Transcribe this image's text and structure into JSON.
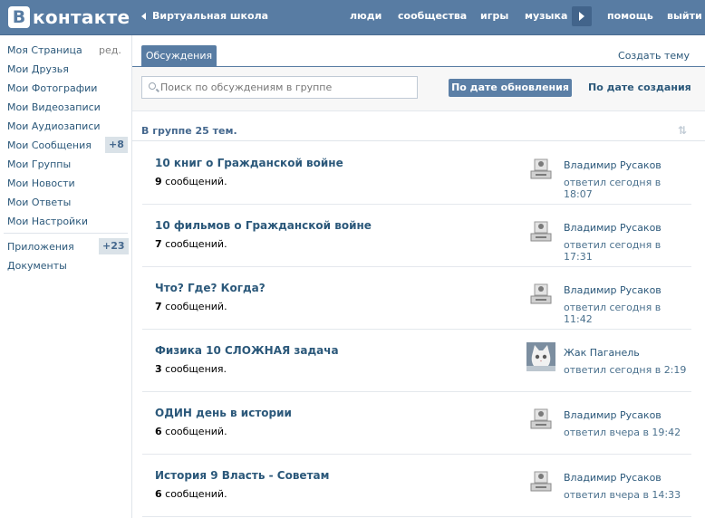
{
  "header": {
    "logo_letter": "В",
    "logo_text": "контакте",
    "back_label": "Виртуальная школа",
    "nav": [
      "люди",
      "сообщества",
      "игры",
      "музыка",
      "помощь",
      "выйти"
    ]
  },
  "sidebar": {
    "items": [
      {
        "label": "Моя Страница"
      },
      {
        "label": "Мои Друзья"
      },
      {
        "label": "Мои Фотографии"
      },
      {
        "label": "Мои Видеозаписи"
      },
      {
        "label": "Мои Аудиозаписи"
      },
      {
        "label": "Мои Сообщения",
        "badge": "+8"
      },
      {
        "label": "Мои Группы"
      },
      {
        "label": "Мои Новости"
      },
      {
        "label": "Мои Ответы"
      },
      {
        "label": "Мои Настройки"
      }
    ],
    "edit_label": "ред.",
    "apps_label": "Приложения",
    "apps_badge": "+23",
    "docs_label": "Документы"
  },
  "main": {
    "tab_label": "Обсуждения",
    "create_label": "Создать тему",
    "search_placeholder": "Поиск по обсуждениям в группе",
    "sort_active": "По дате обновления",
    "sort_other": "По дате создания",
    "count_text": "В группе 25 тем.",
    "topics": [
      {
        "title": "10 книг о Гражданской войне",
        "count": "9",
        "msg_word": " сообщений.",
        "author": "Владимир Русаков",
        "reply": "ответил сегодня в 18:07",
        "avatar": "default-avatar"
      },
      {
        "title": "10 фильмов о Гражданской войне",
        "count": "7",
        "msg_word": " сообщений.",
        "author": "Владимир Русаков",
        "reply": "ответил сегодня в 17:31",
        "avatar": "default-avatar"
      },
      {
        "title": "Что? Где? Когда?",
        "count": "7",
        "msg_word": " сообщений.",
        "author": "Владимир Русаков",
        "reply": "ответил сегодня в 11:42",
        "avatar": "default-avatar"
      },
      {
        "title": "Физика 10 СЛОЖНАЯ задача",
        "count": "3",
        "msg_word": " сообщения.",
        "author": "Жак Паганель",
        "reply": "ответил сегодня в 2:19",
        "avatar": "cat-photo"
      },
      {
        "title": "ОДИН день в истории",
        "count": "6",
        "msg_word": " сообщений.",
        "author": "Владимир Русаков",
        "reply": "ответил вчера в 19:42",
        "avatar": "default-avatar"
      },
      {
        "title": "История 9 Власть - Советам",
        "count": "6",
        "msg_word": " сообщений.",
        "author": "Владимир Русаков",
        "reply": "ответил вчера в 14:33",
        "avatar": "default-avatar"
      }
    ]
  }
}
